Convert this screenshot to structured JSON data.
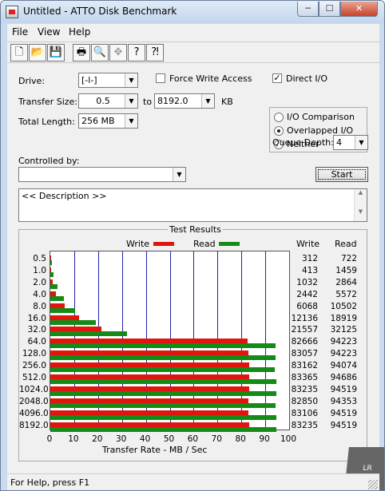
{
  "window": {
    "title": "Untitled - ATTO Disk Benchmark",
    "min_glyph": "─",
    "max_glyph": "☐",
    "close_glyph": "✕"
  },
  "menu": [
    "File",
    "View",
    "Help"
  ],
  "toolbar": {
    "new": "🗋",
    "open": "📂",
    "save": "💾",
    "print": "🖶",
    "preview": "🔍",
    "move": "✥",
    "help": "?",
    "context_help": "⁈"
  },
  "form": {
    "drive_label": "Drive:",
    "drive_value": "[-l-]",
    "force_write_label": "Force Write Access",
    "force_write_checked": false,
    "direct_io_label": "Direct I/O",
    "direct_io_checked": true,
    "transfer_size_label": "Transfer Size:",
    "transfer_from": "0.5",
    "to_label": "to",
    "transfer_to": "8192.0",
    "kb_label": "KB",
    "total_length_label": "Total Length:",
    "total_length_value": "256 MB",
    "io_options": [
      {
        "label": "I/O Comparison",
        "selected": false
      },
      {
        "label": "Overlapped I/O",
        "selected": true
      },
      {
        "label": "Neither",
        "selected": false
      }
    ],
    "queue_depth_label": "Queue Depth:",
    "queue_depth_value": "4",
    "controlled_by_label": "Controlled by:",
    "controlled_by_value": "",
    "start_label": "Start",
    "description": "<< Description >>"
  },
  "results": {
    "group_title": "Test Results",
    "legend_write": "Write",
    "legend_read": "Read",
    "col_write": "Write",
    "col_read": "Read",
    "write_color": "#e0160e",
    "read_color": "#168a16"
  },
  "chart_data": {
    "type": "bar",
    "orientation": "horizontal",
    "xlabel": "Transfer Rate - MB / Sec",
    "xlim": [
      0,
      100
    ],
    "xticks": [
      "0",
      "10",
      "20",
      "30",
      "40",
      "50",
      "60",
      "70",
      "80",
      "90",
      "100"
    ],
    "grid": true,
    "legend_position": "top",
    "categories": [
      "0.5",
      "1.0",
      "2.0",
      "4.0",
      "8.0",
      "16.0",
      "32.0",
      "64.0",
      "128.0",
      "256.0",
      "512.0",
      "1024.0",
      "2048.0",
      "4096.0",
      "8192.0"
    ],
    "series": [
      {
        "name": "Write",
        "values": [
          312,
          413,
          1032,
          2442,
          6068,
          12136,
          21557,
          82666,
          83057,
          83162,
          83365,
          83235,
          82850,
          83106,
          83235
        ]
      },
      {
        "name": "Read",
        "values": [
          722,
          1459,
          2864,
          5572,
          10502,
          18919,
          32125,
          94223,
          94223,
          94074,
          94686,
          94519,
          94353,
          94519,
          94519
        ]
      }
    ]
  },
  "status": {
    "text": "For Help, press F1"
  }
}
